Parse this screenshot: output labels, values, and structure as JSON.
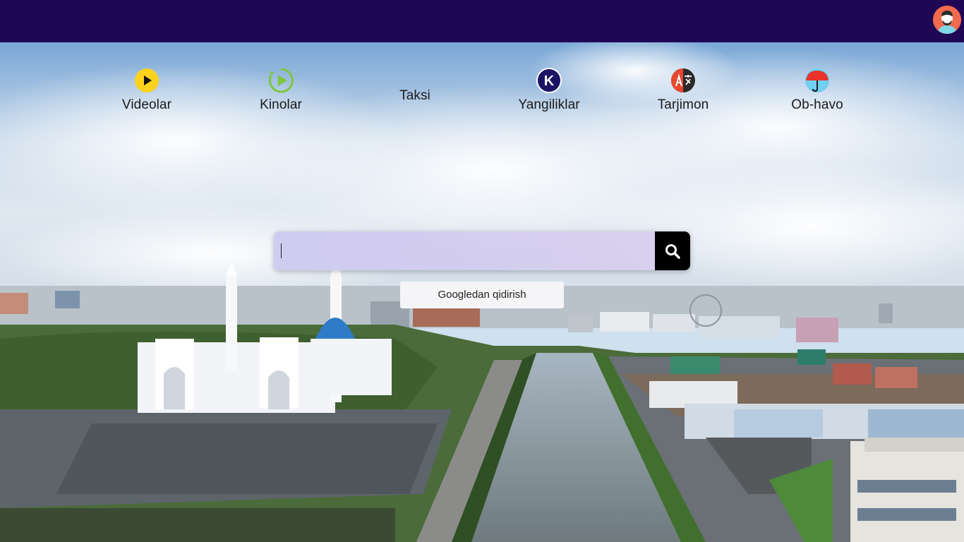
{
  "header": {
    "avatar": "user-avatar"
  },
  "nav": {
    "items": [
      {
        "label": "Videolar",
        "icon": "play-icon"
      },
      {
        "label": "Kinolar",
        "icon": "movie-play-icon"
      },
      {
        "label": "Taksi",
        "icon": ""
      },
      {
        "label": "Yangiliklar",
        "icon": "k-news-icon"
      },
      {
        "label": "Tarjimon",
        "icon": "translate-icon"
      },
      {
        "label": "Ob-havo",
        "icon": "umbrella-icon"
      }
    ]
  },
  "search": {
    "value": "",
    "placeholder": "",
    "button_icon": "search-icon"
  },
  "google_button": {
    "label": "Googledan qidirish"
  },
  "colors": {
    "topbar": "#200755",
    "search_button": "#000000",
    "avatar_bg": "#f06b4e"
  }
}
